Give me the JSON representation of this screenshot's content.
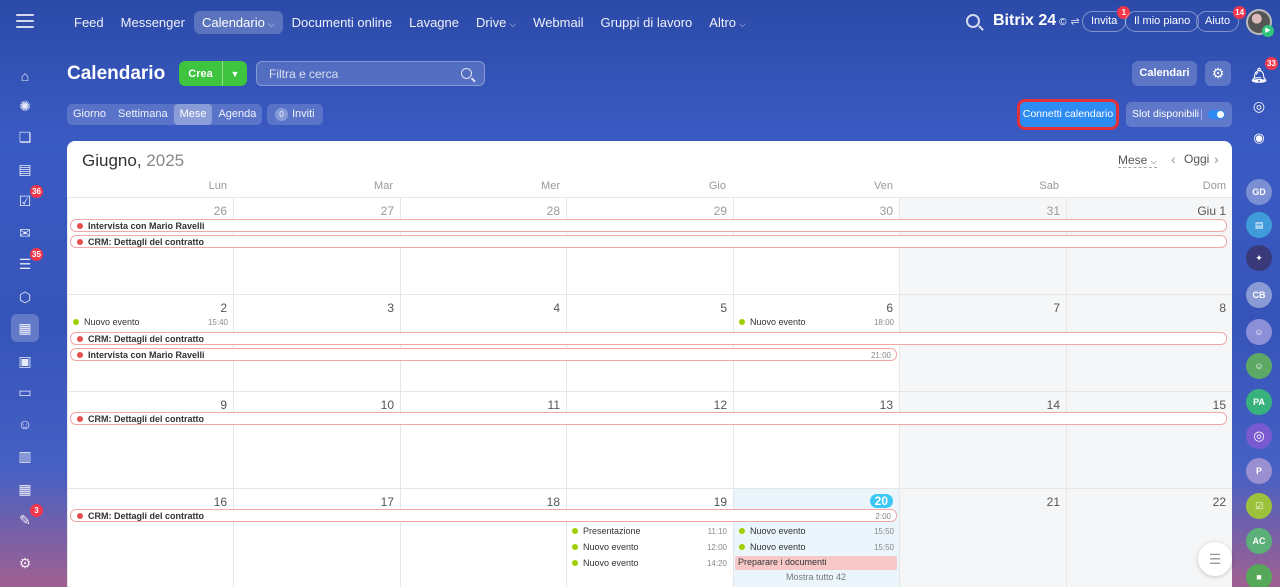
{
  "topbar": {
    "nav": [
      {
        "label": "Feed",
        "caret": false
      },
      {
        "label": "Messenger",
        "caret": false
      },
      {
        "label": "Calendario",
        "caret": true,
        "active": true
      },
      {
        "label": "Documenti online",
        "caret": false
      },
      {
        "label": "Lavagne",
        "caret": false
      },
      {
        "label": "Drive",
        "caret": true
      },
      {
        "label": "Webmail",
        "caret": false
      },
      {
        "label": "Gruppi di lavoro",
        "caret": false
      },
      {
        "label": "Altro",
        "caret": true
      }
    ],
    "brand": "Bitrix 24",
    "brand_symbol": "©",
    "invita": "Invita",
    "invita_badge": "1",
    "piano": "Il mio piano",
    "aiuto": "Aiuto",
    "aiuto_badge": "14"
  },
  "leftbar": {
    "badges": {
      "tasks": "36",
      "feed": "35",
      "approvals": "3"
    }
  },
  "rightbar": {
    "notifications_badge": "33",
    "avatars": [
      "GD",
      "CB",
      "PA",
      "P",
      "AC"
    ]
  },
  "header": {
    "title": "Calendario",
    "create": "Crea",
    "filter_placeholder": "Filtra e cerca",
    "calendari": "Calendari",
    "connetti": "Connetti calendario",
    "slot": "Slot disponibili",
    "views": [
      "Giorno",
      "Settimana",
      "Mese",
      "Agenda"
    ],
    "active_view": "Mese",
    "inviti_count": "0",
    "inviti": "Inviti"
  },
  "calendar": {
    "month": "Giugno,",
    "year": "2025",
    "view_selector": "Mese",
    "today_label": "Oggi",
    "weekdays": [
      "Lun",
      "Mar",
      "Mer",
      "Gio",
      "Ven",
      "Sab",
      "Dom"
    ],
    "weeks": [
      [
        "26",
        "27",
        "28",
        "29",
        "30",
        "31",
        "Giu 1"
      ],
      [
        "2",
        "3",
        "4",
        "5",
        "6",
        "7",
        "8"
      ],
      [
        "9",
        "10",
        "11",
        "12",
        "13",
        "14",
        "15"
      ],
      [
        "16",
        "17",
        "18",
        "19",
        "20",
        "21",
        "22"
      ]
    ],
    "today": "20",
    "events": {
      "intervista": "Intervista con Mario Ravelli",
      "crm": "CRM: Dettagli del contratto",
      "nuovo": "Nuovo evento",
      "presentazione": "Presentazione",
      "preparare": "Preparare i documenti",
      "t1540": "15:40",
      "t1800": "18:00",
      "t2100": "21:00",
      "t200": "2:00",
      "t1110": "11:10",
      "t1200": "12:00",
      "t1420": "14:20",
      "t1550a": "15:50",
      "t1550b": "15:50",
      "more": "Mostra tutto 42"
    },
    "colors": {
      "red_dot": "#e84d4d",
      "green_dot": "#9dcf00",
      "today_badge": "#3bc8f5"
    }
  }
}
